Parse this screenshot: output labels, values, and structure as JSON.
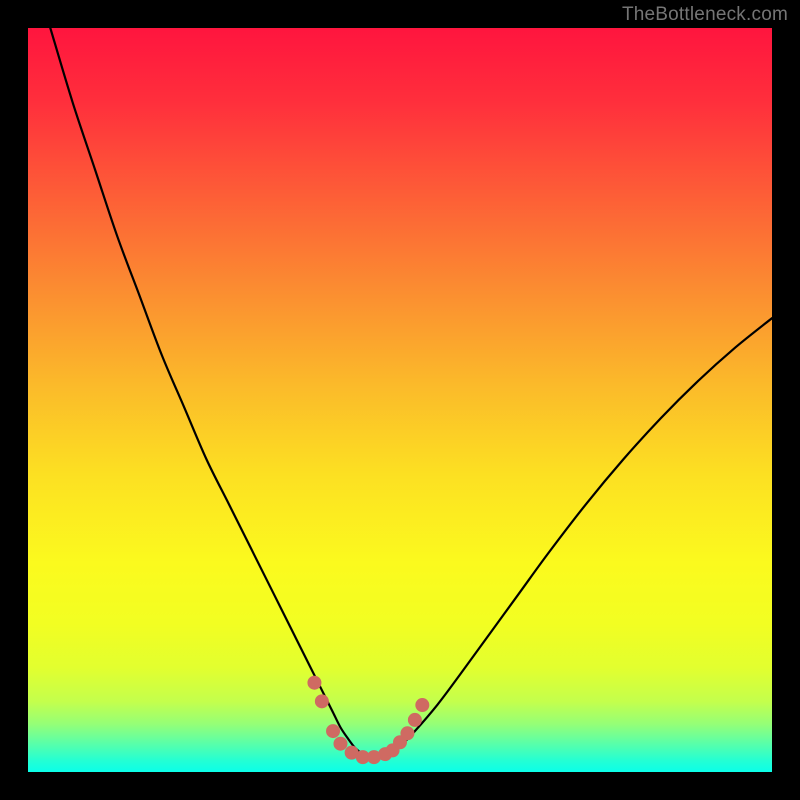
{
  "attribution": "TheBottleneck.com",
  "colors": {
    "curve": "#000000",
    "marker_fill": "#cf6a62",
    "marker_stroke": "#cf6a62",
    "frame": "#000000"
  },
  "chart_data": {
    "type": "line",
    "title": "",
    "xlabel": "",
    "ylabel": "",
    "xlim": [
      0,
      100
    ],
    "ylim": [
      0,
      100
    ],
    "gradient_stops": [
      {
        "offset": 0.0,
        "color": "#ff153e"
      },
      {
        "offset": 0.1,
        "color": "#ff2f3c"
      },
      {
        "offset": 0.22,
        "color": "#fd5c37"
      },
      {
        "offset": 0.35,
        "color": "#fb8c31"
      },
      {
        "offset": 0.48,
        "color": "#fbba2a"
      },
      {
        "offset": 0.6,
        "color": "#fce022"
      },
      {
        "offset": 0.72,
        "color": "#fbfa1e"
      },
      {
        "offset": 0.8,
        "color": "#f2fe22"
      },
      {
        "offset": 0.86,
        "color": "#e2ff2f"
      },
      {
        "offset": 0.905,
        "color": "#c4ff4c"
      },
      {
        "offset": 0.935,
        "color": "#96ff76"
      },
      {
        "offset": 0.96,
        "color": "#5dffa6"
      },
      {
        "offset": 0.985,
        "color": "#23ffd4"
      },
      {
        "offset": 1.0,
        "color": "#0bffe9"
      }
    ],
    "series": [
      {
        "name": "bottleneck-curve",
        "x": [
          3,
          6,
          9,
          12,
          15,
          18,
          21,
          24,
          27,
          30,
          33,
          36,
          38,
          40,
          41,
          42,
          43,
          44,
          45,
          46,
          47,
          48,
          50,
          52,
          55,
          58,
          62,
          66,
          70,
          75,
          80,
          85,
          90,
          95,
          100
        ],
        "y": [
          100,
          90,
          81,
          72,
          64,
          56,
          49,
          42,
          36,
          30,
          24,
          18,
          14,
          10,
          8,
          6,
          4.5,
          3.2,
          2.4,
          2.0,
          2.0,
          2.4,
          3.5,
          5.5,
          9,
          13,
          18.5,
          24,
          29.5,
          36,
          42,
          47.5,
          52.5,
          57,
          61
        ]
      }
    ],
    "markers": {
      "shape": "rounded",
      "radius_px": 6.5,
      "points": [
        {
          "x": 38.5,
          "y": 12
        },
        {
          "x": 39.5,
          "y": 9.5
        },
        {
          "x": 41.0,
          "y": 5.5
        },
        {
          "x": 42.0,
          "y": 3.8
        },
        {
          "x": 43.5,
          "y": 2.6
        },
        {
          "x": 45.0,
          "y": 2.0
        },
        {
          "x": 46.5,
          "y": 2.0
        },
        {
          "x": 48.0,
          "y": 2.4
        },
        {
          "x": 49.0,
          "y": 2.9
        },
        {
          "x": 50.0,
          "y": 4.0
        },
        {
          "x": 51.0,
          "y": 5.2
        },
        {
          "x": 52.0,
          "y": 7.0
        },
        {
          "x": 53.0,
          "y": 9.0
        }
      ]
    }
  }
}
